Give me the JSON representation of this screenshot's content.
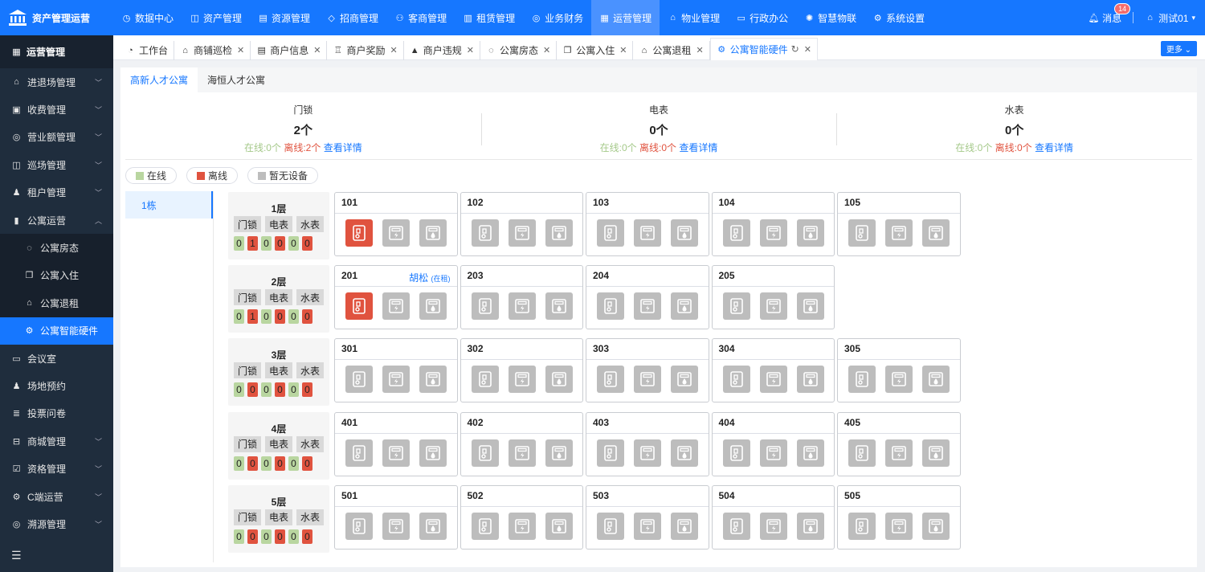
{
  "app": {
    "title": "资产管理运营"
  },
  "topnav": [
    {
      "label": "数据中心",
      "icon": "clock-icon",
      "active": false
    },
    {
      "label": "资产管理",
      "icon": "cube-icon",
      "active": false
    },
    {
      "label": "资源管理",
      "icon": "document-icon",
      "active": false
    },
    {
      "label": "招商管理",
      "icon": "tag-icon",
      "active": false
    },
    {
      "label": "客商管理",
      "icon": "users-icon",
      "active": false
    },
    {
      "label": "租赁管理",
      "icon": "building-icon",
      "active": false
    },
    {
      "label": "业务财务",
      "icon": "coin-icon",
      "active": false
    },
    {
      "label": "运营管理",
      "icon": "chart-icon",
      "active": true
    },
    {
      "label": "物业管理",
      "icon": "home-icon",
      "active": false
    },
    {
      "label": "行政办公",
      "icon": "monitor-icon",
      "active": false
    },
    {
      "label": "智慧物联",
      "icon": "iot-icon",
      "active": false
    },
    {
      "label": "系统设置",
      "icon": "gear-icon",
      "active": false
    }
  ],
  "user": {
    "messages_label": "消息",
    "messages_count": "14",
    "name": "测试01"
  },
  "sidebar": {
    "header": "运营管理",
    "items": [
      {
        "label": "进退场管理",
        "icon": "home-icon",
        "arrow": "down"
      },
      {
        "label": "收费管理",
        "icon": "wallet-icon",
        "arrow": "down"
      },
      {
        "label": "营业额管理",
        "icon": "coin-icon",
        "arrow": "down"
      },
      {
        "label": "巡场管理",
        "icon": "map-icon",
        "arrow": "down"
      },
      {
        "label": "租户管理",
        "icon": "user-icon",
        "arrow": "down"
      },
      {
        "label": "公寓运营",
        "icon": "bar-chart-icon",
        "arrow": "up"
      }
    ],
    "subitems": [
      {
        "label": "公寓房态",
        "icon": "compass-icon",
        "active": false
      },
      {
        "label": "公寓入住",
        "icon": "copy-icon",
        "active": false
      },
      {
        "label": "公寓退租",
        "icon": "home-icon",
        "active": false
      },
      {
        "label": "公寓智能硬件",
        "icon": "gear-icon",
        "active": true
      }
    ],
    "items2": [
      {
        "label": "会议室",
        "icon": "screen-icon",
        "arrow": ""
      },
      {
        "label": "场地预约",
        "icon": "user-icon",
        "arrow": ""
      },
      {
        "label": "投票问卷",
        "icon": "list-icon",
        "arrow": ""
      },
      {
        "label": "商城管理",
        "icon": "shop-icon",
        "arrow": "down"
      },
      {
        "label": "资格管理",
        "icon": "check-icon",
        "arrow": "down"
      },
      {
        "label": "C端运营",
        "icon": "gear-icon",
        "arrow": "down"
      },
      {
        "label": "溯源管理",
        "icon": "target-icon",
        "arrow": "down"
      }
    ]
  },
  "tabs": [
    {
      "label": "工作台",
      "icon": "dashboard-icon",
      "closable": false,
      "active": false
    },
    {
      "label": "商铺巡检",
      "icon": "home-icon",
      "closable": true,
      "active": false
    },
    {
      "label": "商户信息",
      "icon": "document-icon",
      "closable": true,
      "active": false
    },
    {
      "label": "商户奖励",
      "icon": "gift-icon",
      "closable": true,
      "active": false
    },
    {
      "label": "商户违规",
      "icon": "warning-icon",
      "closable": true,
      "active": false
    },
    {
      "label": "公寓房态",
      "icon": "compass-icon",
      "closable": true,
      "active": false
    },
    {
      "label": "公寓入住",
      "icon": "copy-icon",
      "closable": true,
      "active": false
    },
    {
      "label": "公寓退租",
      "icon": "home-icon",
      "closable": true,
      "active": false
    },
    {
      "label": "公寓智能硬件",
      "icon": "gear-icon",
      "closable": true,
      "active": true
    }
  ],
  "more_label": "更多",
  "apartment_tabs": [
    {
      "label": "高新人才公寓",
      "active": true
    },
    {
      "label": "海恒人才公寓",
      "active": false
    }
  ],
  "stats": [
    {
      "title": "门锁",
      "count": "2个",
      "online_label": "在线:",
      "online": "0个",
      "offline_label": "离线:",
      "offline": "2个",
      "link": "查看详情"
    },
    {
      "title": "电表",
      "count": "0个",
      "online_label": "在线:",
      "online": "0个",
      "offline_label": "离线:",
      "offline": "0个",
      "link": "查看详情"
    },
    {
      "title": "水表",
      "count": "0个",
      "online_label": "在线:",
      "online": "0个",
      "offline_label": "离线:",
      "offline": "0个",
      "link": "查看详情"
    }
  ],
  "legend": [
    {
      "label": "在线",
      "color": "#b9d6a0"
    },
    {
      "label": "离线",
      "color": "#e0533f"
    },
    {
      "label": "暂无设备",
      "color": "#bdbdbd"
    }
  ],
  "buildings": [
    {
      "label": "1栋",
      "active": true
    }
  ],
  "device_heads": [
    "门锁",
    "电表",
    "水表"
  ],
  "floors": [
    {
      "name": "1层",
      "counts": [
        0,
        1,
        0,
        0,
        0,
        0
      ],
      "rooms": [
        {
          "num": "101",
          "tenant": "",
          "status": "",
          "devices": [
            "offline",
            "none",
            "none"
          ]
        },
        {
          "num": "102",
          "tenant": "",
          "status": "",
          "devices": [
            "none",
            "none",
            "none"
          ]
        },
        {
          "num": "103",
          "tenant": "",
          "status": "",
          "devices": [
            "none",
            "none",
            "none"
          ]
        },
        {
          "num": "104",
          "tenant": "",
          "status": "",
          "devices": [
            "none",
            "none",
            "none"
          ]
        },
        {
          "num": "105",
          "tenant": "",
          "status": "",
          "devices": [
            "none",
            "none",
            "none"
          ]
        }
      ]
    },
    {
      "name": "2层",
      "counts": [
        0,
        1,
        0,
        0,
        0,
        0
      ],
      "rooms": [
        {
          "num": "201",
          "tenant": "胡松",
          "status": "(在租)",
          "devices": [
            "offline",
            "none",
            "none"
          ]
        },
        {
          "num": "203",
          "tenant": "",
          "status": "",
          "devices": [
            "none",
            "none",
            "none"
          ]
        },
        {
          "num": "204",
          "tenant": "",
          "status": "",
          "devices": [
            "none",
            "none",
            "none"
          ]
        },
        {
          "num": "205",
          "tenant": "",
          "status": "",
          "devices": [
            "none",
            "none",
            "none"
          ]
        }
      ]
    },
    {
      "name": "3层",
      "counts": [
        0,
        0,
        0,
        0,
        0,
        0
      ],
      "rooms": [
        {
          "num": "301",
          "tenant": "",
          "status": "",
          "devices": [
            "none",
            "none",
            "none"
          ]
        },
        {
          "num": "302",
          "tenant": "",
          "status": "",
          "devices": [
            "none",
            "none",
            "none"
          ]
        },
        {
          "num": "303",
          "tenant": "",
          "status": "",
          "devices": [
            "none",
            "none",
            "none"
          ]
        },
        {
          "num": "304",
          "tenant": "",
          "status": "",
          "devices": [
            "none",
            "none",
            "none"
          ]
        },
        {
          "num": "305",
          "tenant": "",
          "status": "",
          "devices": [
            "none",
            "none",
            "none"
          ]
        }
      ]
    },
    {
      "name": "4层",
      "counts": [
        0,
        0,
        0,
        0,
        0,
        0
      ],
      "rooms": [
        {
          "num": "401",
          "tenant": "",
          "status": "",
          "devices": [
            "none",
            "none",
            "none"
          ]
        },
        {
          "num": "402",
          "tenant": "",
          "status": "",
          "devices": [
            "none",
            "none",
            "none"
          ]
        },
        {
          "num": "403",
          "tenant": "",
          "status": "",
          "devices": [
            "none",
            "none",
            "none"
          ]
        },
        {
          "num": "404",
          "tenant": "",
          "status": "",
          "devices": [
            "none",
            "none",
            "none"
          ]
        },
        {
          "num": "405",
          "tenant": "",
          "status": "",
          "devices": [
            "none",
            "none",
            "none"
          ]
        }
      ]
    },
    {
      "name": "5层",
      "counts": [
        0,
        0,
        0,
        0,
        0,
        0
      ],
      "rooms": [
        {
          "num": "501",
          "tenant": "",
          "status": "",
          "devices": [
            "none",
            "none",
            "none"
          ]
        },
        {
          "num": "502",
          "tenant": "",
          "status": "",
          "devices": [
            "none",
            "none",
            "none"
          ]
        },
        {
          "num": "503",
          "tenant": "",
          "status": "",
          "devices": [
            "none",
            "none",
            "none"
          ]
        },
        {
          "num": "504",
          "tenant": "",
          "status": "",
          "devices": [
            "none",
            "none",
            "none"
          ]
        },
        {
          "num": "505",
          "tenant": "",
          "status": "",
          "devices": [
            "none",
            "none",
            "none"
          ]
        }
      ]
    }
  ]
}
